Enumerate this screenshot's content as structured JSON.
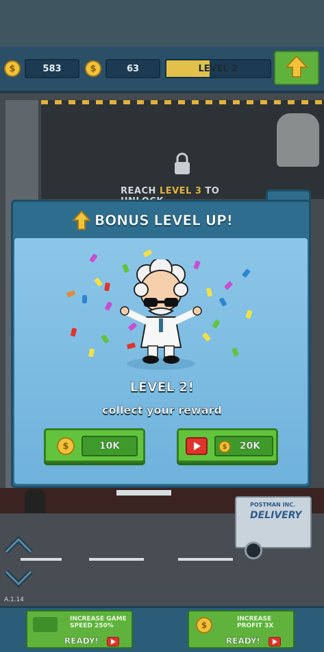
{
  "hud": {
    "coins": "583",
    "gems": "63",
    "level_label": "LEVEL 2",
    "level_progress": 0.42,
    "levelup_button_label": "LEVEL UP!"
  },
  "scene": {
    "unlock_prefix": "REACH",
    "unlock_level": "LEVEL 3",
    "unlock_suffix": "TO UNLOCK"
  },
  "modal": {
    "title": "BONUS LEVEL UP!",
    "level_text": "LEVEL 2!",
    "subtitle": "collect your reward",
    "reward_button_value": "10K",
    "video_button_value": "20K"
  },
  "street": {
    "truck_line1": "POSTMAN INC.",
    "truck_line2": "DELIVERY",
    "version": "A.1.14"
  },
  "boosts": [
    {
      "line1": "INCREASE GAME",
      "line2": "SPEED 250%",
      "status": "READY!"
    },
    {
      "line1": "INCREASE",
      "line2": "PROFIT 3X",
      "status": "READY!"
    }
  ],
  "colors": {
    "accent_green": "#62c43c",
    "modal_blue": "#2f6d8f",
    "coin_gold": "#f3c23b",
    "video_red": "#e0342b"
  }
}
